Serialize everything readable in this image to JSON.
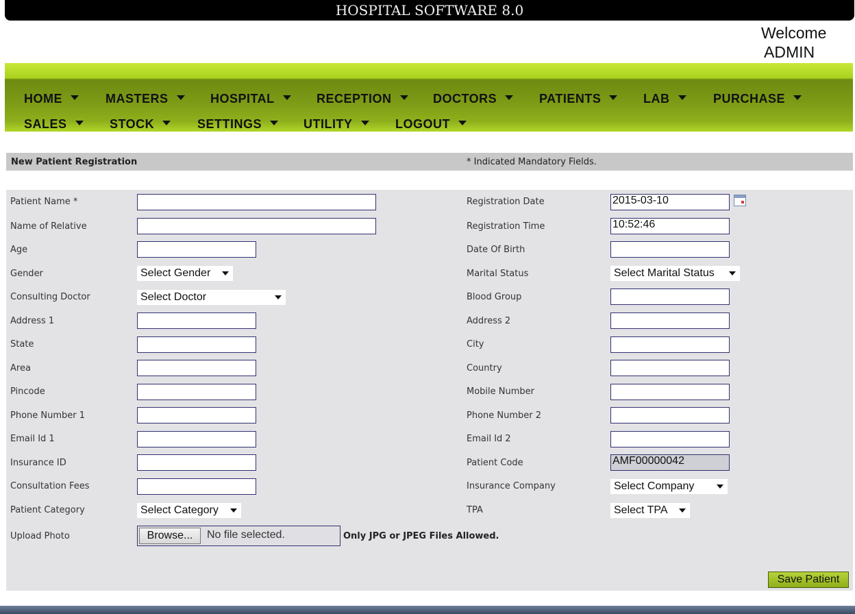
{
  "app": {
    "title": "HOSPITAL SOFTWARE 8.0",
    "welcome": "Welcome",
    "user": "ADMIN"
  },
  "nav": [
    {
      "label": "HOME"
    },
    {
      "label": "MASTERS"
    },
    {
      "label": "HOSPITAL"
    },
    {
      "label": "RECEPTION"
    },
    {
      "label": "DOCTORS"
    },
    {
      "label": "PATIENTS"
    },
    {
      "label": "LAB"
    },
    {
      "label": "PURCHASE"
    },
    {
      "label": "SALES"
    },
    {
      "label": "STOCK"
    },
    {
      "label": "SETTINGS"
    },
    {
      "label": "UTILITY"
    },
    {
      "label": "LOGOUT"
    }
  ],
  "section": {
    "title": "New Patient Registration",
    "note": "* Indicated Mandatory Fields."
  },
  "left_fields": [
    {
      "label": "Patient Name *",
      "value": ""
    },
    {
      "label": "Name of Relative",
      "value": ""
    },
    {
      "label": "Age",
      "value": ""
    },
    {
      "label": "Gender",
      "value": "Select Gender"
    },
    {
      "label": "Consulting Doctor",
      "value": "Select Doctor"
    },
    {
      "label": "Address 1",
      "value": ""
    },
    {
      "label": "State",
      "value": ""
    },
    {
      "label": "Area",
      "value": ""
    },
    {
      "label": "Pincode",
      "value": ""
    },
    {
      "label": "Phone Number 1",
      "value": ""
    },
    {
      "label": "Email Id 1",
      "value": ""
    },
    {
      "label": "Insurance ID",
      "value": ""
    },
    {
      "label": "Consultation Fees",
      "value": ""
    },
    {
      "label": "Patient Category",
      "value": "Select Category"
    },
    {
      "label": "Upload Photo",
      "value": ""
    }
  ],
  "right_fields": [
    {
      "label": "Registration Date",
      "value": "2015-03-10"
    },
    {
      "label": "Registration Time",
      "value": "10:52:46"
    },
    {
      "label": "Date Of Birth",
      "value": ""
    },
    {
      "label": "Marital Status",
      "value": "Select Marital Status"
    },
    {
      "label": "Blood Group",
      "value": ""
    },
    {
      "label": "Address 2",
      "value": ""
    },
    {
      "label": "City",
      "value": ""
    },
    {
      "label": "Country",
      "value": ""
    },
    {
      "label": "Mobile Number",
      "value": ""
    },
    {
      "label": "Phone Number 2",
      "value": ""
    },
    {
      "label": "Email Id 2",
      "value": ""
    },
    {
      "label": "Patient Code",
      "value": "AMF00000042"
    },
    {
      "label": "Insurance Company",
      "value": "Select Company"
    },
    {
      "label": "TPA",
      "value": "Select TPA"
    }
  ],
  "upload": {
    "browse_label": "Browse...",
    "status": "No file selected.",
    "note": "Only JPG or JPEG Files Allowed."
  },
  "actions": {
    "save_label": "Save Patient"
  },
  "icons": {
    "calendar": "calendar-icon",
    "dropdown": "chevron-down-icon"
  },
  "colors": {
    "nav_green": "#7e9c16",
    "accent_green": "#a8d21c",
    "title_bar": "#000000"
  }
}
